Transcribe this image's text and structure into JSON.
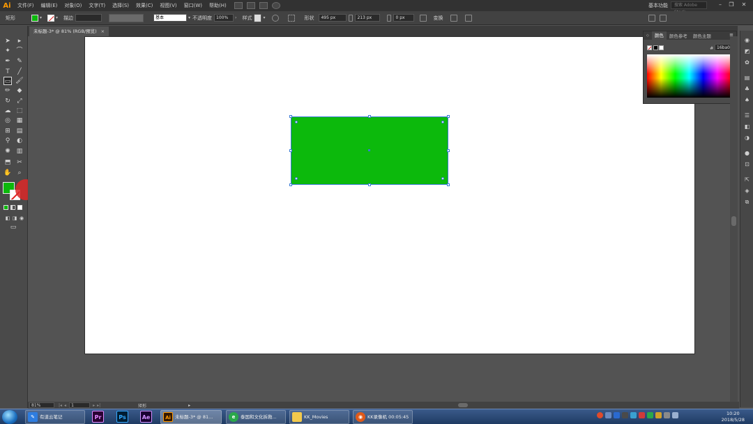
{
  "app": {
    "logo": "Ai"
  },
  "menu": {
    "items": [
      "文件(F)",
      "编辑(E)",
      "对象(O)",
      "文字(T)",
      "选择(S)",
      "效果(C)",
      "视图(V)",
      "窗口(W)",
      "帮助(H)"
    ],
    "workspace": "基本功能",
    "stock_search_placeholder": "搜索 Adobe Stock"
  },
  "control_bar": {
    "object_type": "矩形",
    "stroke_label": "描边",
    "stroke_profile": "基本",
    "opacity_label": "不透明度",
    "opacity_value": "100%",
    "style_label": "样式",
    "shape_label": "形状",
    "width_value": "495 px",
    "height_value": "213 px",
    "corner_value": "0 px",
    "transform_label": "变换"
  },
  "document": {
    "tab_label": "未标题-3* @ 81% (RGB/预览)",
    "close": "×"
  },
  "color_panel": {
    "tabs": [
      "颜色",
      "颜色参考",
      "颜色主题"
    ],
    "hex_label": "#",
    "hex_value": "16ba00"
  },
  "status_bar": {
    "zoom": "81%",
    "artboard_nav": "1",
    "tool_name": "矩形"
  },
  "taskbar": {
    "buttons": [
      {
        "label": "有道云笔记"
      },
      {
        "label": "未标题-3* @ 81..."
      },
      {
        "label": "泰国和文化拆救..."
      },
      {
        "label": "KK_Movies"
      },
      {
        "label": "KK录像机 00:05:45"
      }
    ],
    "apps": [
      "Pr",
      "Ps",
      "Ae",
      "Ai"
    ],
    "clock_time": "10:20",
    "clock_date": "2018/5/28"
  },
  "colors": {
    "fill": "#0cb90c",
    "selection": "#3a7bd5",
    "accent": "#ff9a00"
  }
}
